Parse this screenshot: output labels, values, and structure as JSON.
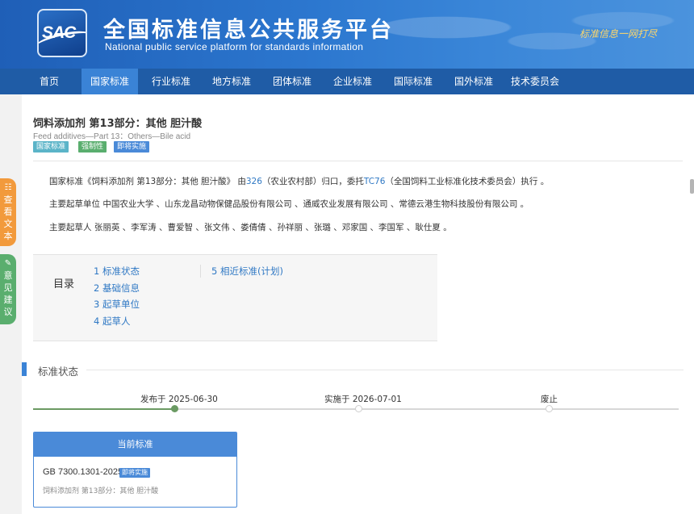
{
  "header": {
    "logo_text": "SAC",
    "title_cn": "全国标准信息公共服务平台",
    "title_en": "National public service platform  for standards information",
    "slogan": "标准信息一网打尽"
  },
  "nav": {
    "items": [
      {
        "label": "首页"
      },
      {
        "label": "国家标准"
      },
      {
        "label": "行业标准"
      },
      {
        "label": "地方标准"
      },
      {
        "label": "团体标准"
      },
      {
        "label": "企业标准"
      },
      {
        "label": "国际标准"
      },
      {
        "label": "国外标准"
      },
      {
        "label": "技术委员会"
      }
    ],
    "active": "国家标准"
  },
  "standard": {
    "title": "饲料添加剂 第13部分：其他 胆汁酸",
    "title_en": "Feed additives—Part 13：Others—Bile acid",
    "badges": [
      {
        "label": "国家标准",
        "color": "#5bb4c8"
      },
      {
        "label": "强制性",
        "color": "#5aae6e"
      },
      {
        "label": "即将实施",
        "color": "#4a8ad8"
      }
    ]
  },
  "info": {
    "line1_prefix": "国家标准《饲料添加剂 第13部分：其他 胆汁酸》 由",
    "line1_link1": "326",
    "line1_mid": "（农业农村部）归口，委托",
    "line1_link2": "TC76",
    "line1_suffix": "（全国饲料工业标准化技术委员会）执行 。",
    "line2": "主要起草单位 中国农业大学 、山东龙昌动物保健品股份有限公司 、通威农业发展有限公司 、常德云港生物科技股份有限公司 。",
    "line3": "主要起草人 张丽英 、李军涛 、曹爱智 、张文伟 、娄倩倩 、孙祥丽 、张璐 、邓家国 、李国军 、耿仕夏 。"
  },
  "toc": {
    "label": "目录",
    "items": [
      {
        "label": "1  标准状态"
      },
      {
        "label": "2  基础信息"
      },
      {
        "label": "3  起草单位"
      },
      {
        "label": "4  起草人"
      },
      {
        "label": "5  相近标准(计划)"
      }
    ]
  },
  "status_section": {
    "title": "标准状态",
    "timeline": [
      {
        "label": "发布于 2025-06-30",
        "done": true
      },
      {
        "label": "实施于 2026-07-01",
        "done": false
      },
      {
        "label": "废止",
        "done": false
      }
    ]
  },
  "current_card": {
    "header": "当前标准",
    "code": "GB 7300.1301-2025",
    "badge": "即将实施",
    "subtitle": "饲料添加剂 第13部分：其他 胆汁酸"
  },
  "float_buttons": [
    {
      "icon": "document-icon",
      "label": "查看文本",
      "chars": [
        "查",
        "看",
        "文",
        "本"
      ]
    },
    {
      "icon": "feedback-icon",
      "label": "意见建议",
      "chars": [
        "意",
        "见",
        "建",
        "议"
      ]
    }
  ]
}
